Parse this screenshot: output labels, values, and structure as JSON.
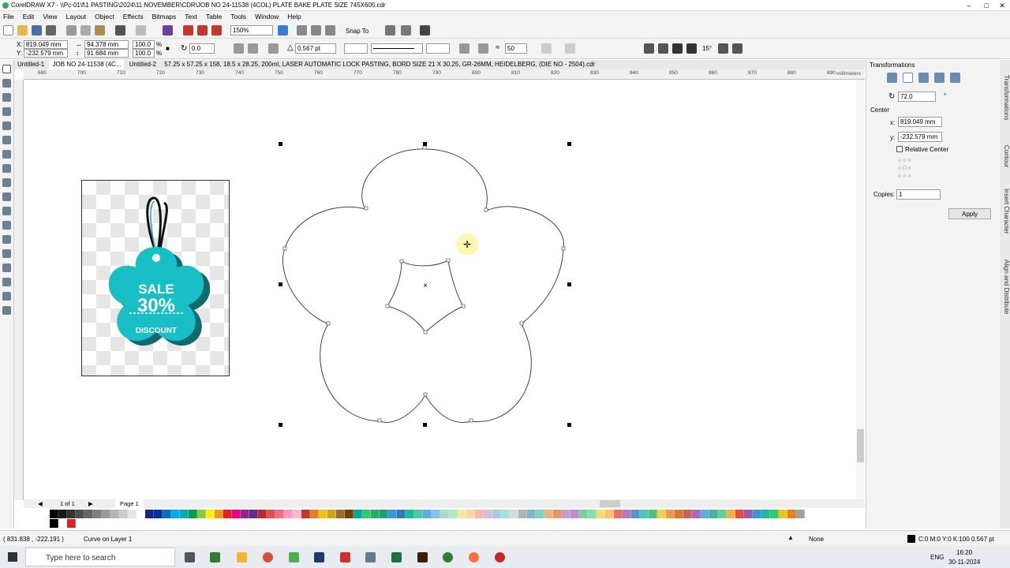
{
  "window": {
    "title": "CorelDRAW X7 - \\\\Pc-01\\f\\1 PASTING\\2024\\11 NOVEMBER\\CDR\\JOB NO 24-11538 (4COL) PLATE BAKE PLATE SIZE 745X605.cdr"
  },
  "menu": [
    "File",
    "Edit",
    "View",
    "Layout",
    "Object",
    "Effects",
    "Bitmaps",
    "Text",
    "Table",
    "Tools",
    "Window",
    "Help"
  ],
  "toolbar": {
    "zoom": "150%",
    "snap_to": "Snap To"
  },
  "props": {
    "x": "819.049 mm",
    "y": "-232.579 mm",
    "w": "94.378 mm",
    "h": "91.684 mm",
    "scale_w": "100.0",
    "scale_h": "100.0",
    "percent": "%",
    "angle": "0.0",
    "outline_width": "0.567 pt",
    "smooth": "50",
    "degrees": "15°"
  },
  "doc_tabs": [
    "Untitled-1",
    "JOB NO 24-11538 (4C...",
    "Untitled-2",
    "57.25 x 57.25 x 158, 18.5 x 28.25, 200ml, LASER AUTOMATIC LOCK PASTING, BORD SIZE 21 X 30.25, GR-26MM, HEIDELBERG, (DIE NO - 2504).cdr"
  ],
  "ruler": {
    "units": "millimeters",
    "ticks": [
      "690",
      "700",
      "710",
      "720",
      "730",
      "740",
      "750",
      "760",
      "770",
      "780",
      "790",
      "800",
      "810",
      "820",
      "830",
      "840",
      "850",
      "860",
      "870",
      "880",
      "890"
    ]
  },
  "tag_image": {
    "line1": "SALE",
    "line2": "30%",
    "line3": "DISCOUNT"
  },
  "page_nav": {
    "count": "1 of 1",
    "page": "Page 1"
  },
  "docker": {
    "title": "Transformations",
    "angle": "72.0",
    "degree_sign": "°",
    "center_label": "Center",
    "cx_label": "x:",
    "cx": "819.049 mm",
    "cy_label": "y:",
    "cy": "-232.579 mm",
    "relative_center": "Relative Center",
    "copies_label": "Copies:",
    "copies": "1",
    "apply": "Apply"
  },
  "docker_tabs": [
    "Transformations",
    "Contour",
    "Insert Character",
    "Align and Distribute"
  ],
  "palette_row1": [
    "#ffffff",
    "#000000",
    "#1a1a1a",
    "#333333",
    "#4d4d4d",
    "#666666",
    "#808080",
    "#999999",
    "#b3b3b3",
    "#cccccc",
    "#e6e6e6",
    "#ffffff",
    "#1a237e",
    "#0033a0",
    "#0070c0",
    "#00aeef",
    "#00b0b9",
    "#009e49",
    "#8dc63f",
    "#fff200",
    "#f7941d",
    "#ed1c24",
    "#ec008c",
    "#92278f",
    "#662d91",
    "#c1272d",
    "#e2504b",
    "#f26d7d",
    "#f49ac1",
    "#f8b8cf",
    "#c0392b",
    "#e67e22",
    "#f1c40f",
    "#d4a017",
    "#9c6b30",
    "#7b3f00",
    "#00a99d",
    "#2ecc71",
    "#27ae60",
    "#16a085",
    "#3498db",
    "#2980b9",
    "#1abc9c",
    "#48c9b0",
    "#5dade2",
    "#85c1e9",
    "#a9dfbf",
    "#abebc6",
    "#f9e79f",
    "#fad7a0",
    "#f5b7b1",
    "#d7bde2",
    "#a9cce3",
    "#a3e4d7",
    "#d5dbdb",
    "#aab7b8",
    "#7fb3d5",
    "#76d7c4",
    "#f0b27a",
    "#e59866",
    "#c39bd3",
    "#bb8fce",
    "#7dcea0",
    "#82e0aa",
    "#f7dc6f",
    "#f8c471",
    "#ec7063",
    "#af7ac5",
    "#5499c7",
    "#48c9b0",
    "#52be80",
    "#f4d03f",
    "#eb984e",
    "#dc7633",
    "#cd6155",
    "#a569bd",
    "#5dade2",
    "#45b39d",
    "#58d68d",
    "#f5b041",
    "#e74c3c",
    "#9b59b6",
    "#3498db",
    "#1abc9c",
    "#2ecc71",
    "#f1c40f",
    "#e67e22",
    "#95a5a6"
  ],
  "palette_row2": [
    "#ffffff",
    "#000000",
    "#ffffff",
    "#e31e24"
  ],
  "status": {
    "coords": "( 831.838 , -222.191 )",
    "layer": "Curve on Layer 1",
    "fill": "None",
    "outline": "C:0 M:0 Y:0 K:100  0.567 pt"
  },
  "taskbar": {
    "search": "Type here to search",
    "lang": "ENG",
    "time": "16:20",
    "date": "30-11-2024"
  }
}
